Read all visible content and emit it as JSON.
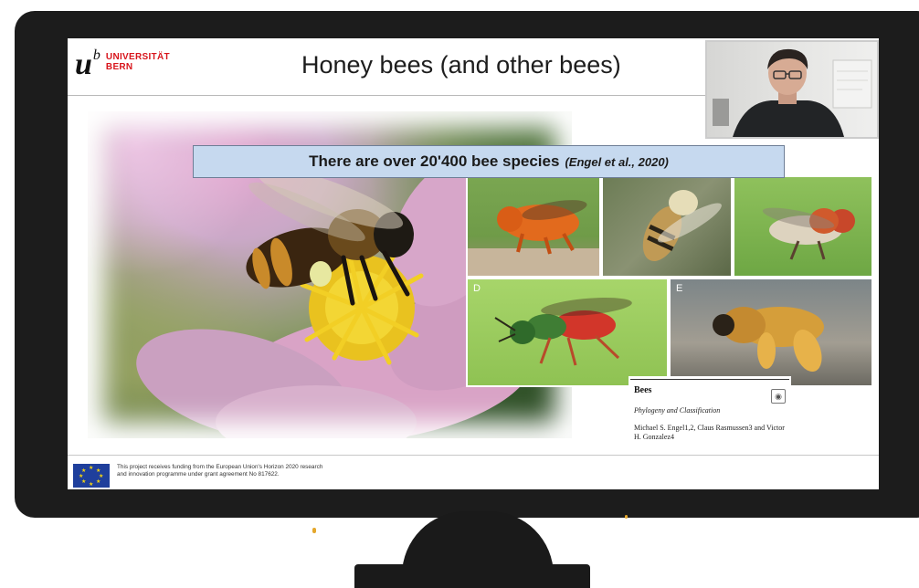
{
  "slide": {
    "logo": {
      "letter": "u",
      "superscript": "b",
      "line1": "UNIVERSITÄT",
      "line2": "BERN"
    },
    "title": "Honey bees (and other bees)",
    "banner": {
      "text": "There are over 20'400 bee species",
      "citation": "(Engel et al., 2020)"
    },
    "panels": [
      {
        "letter": ""
      },
      {
        "letter": ""
      },
      {
        "letter": ""
      },
      {
        "letter": "D"
      },
      {
        "letter": "E"
      }
    ],
    "paper": {
      "title": "Bees",
      "subtitle": "Phylogeny and Classification",
      "authors": "Michael S. Engel1,2, Claus Rasmussen3 and Victor H. Gonzalez4"
    },
    "footer": {
      "text": "This project receives funding from the European Union's Horizon 2020 research and innovation programme under grant agreement No 817622."
    }
  },
  "colors": {
    "monitor": "#1c1c1c",
    "banner_bg": "#c6d9ef",
    "logo_red": "#d8151c",
    "eu_blue": "#1f3f9c"
  },
  "icons": [
    "eu-flag-icon",
    "open-access-icon"
  ]
}
